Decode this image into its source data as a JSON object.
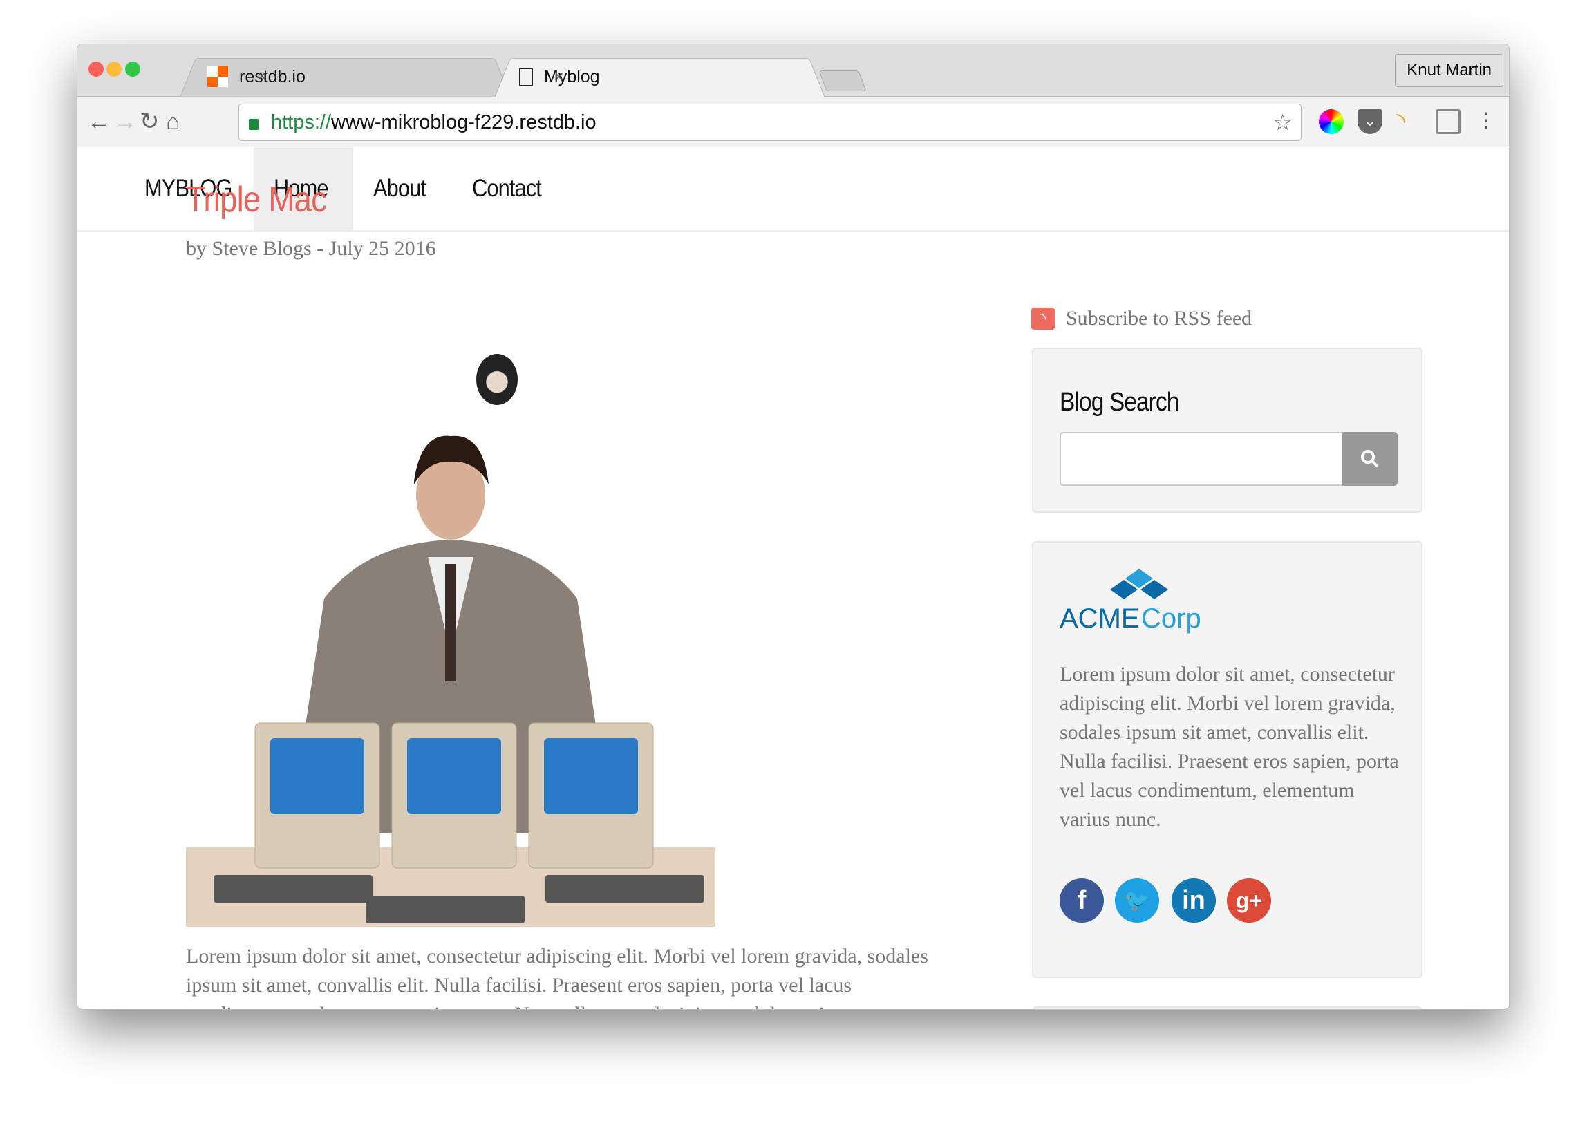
{
  "browser": {
    "tabs": [
      {
        "label": "restdb.io",
        "close": "×"
      },
      {
        "label": "Myblog",
        "close": "×"
      }
    ],
    "user": "Knut Martin",
    "url_scheme": "https://",
    "url_host": "www-mikroblog-f229.restdb.io",
    "icons": [
      "back-arrow",
      "forward-arrow",
      "reload",
      "home",
      "lock",
      "star",
      "color-picker",
      "pocket",
      "rss",
      "cast",
      "menu"
    ]
  },
  "nav": {
    "brand": "MYBLOG",
    "items": [
      {
        "label": "Home",
        "active": true
      },
      {
        "label": "About"
      },
      {
        "label": "Contact"
      }
    ]
  },
  "post": {
    "title": "Triple Mac",
    "byline": "by Steve Blogs - July 25 2016",
    "body": "Lorem ipsum dolor sit amet, consectetur adipiscing elit. Morbi vel lorem gravida, sodales ipsum sit amet, convallis elit. Nulla facilisi. Praesent eros sapien, porta vel lacus condimentum, elementum varius nunc. Nam tellus ante, lacinia nec dolor quis, ornare tristique ante."
  },
  "sidebar": {
    "rss_label": "Subscribe to RSS feed",
    "search_title": "Blog Search",
    "search_value": "",
    "logo_text_1": "ACME",
    "logo_text_2": "Corp",
    "about_text": "Lorem ipsum dolor sit amet, consectetur adipiscing elit. Morbi vel lorem gravida, sodales ipsum sit amet, convallis elit. Nulla facilisi. Praesent eros sapien, porta vel lacus condimentum, elementum varius nunc.",
    "social": [
      {
        "name": "facebook",
        "glyph": "f",
        "color": "#3b5998"
      },
      {
        "name": "twitter",
        "glyph": "🐦",
        "color": "#1da1e2"
      },
      {
        "name": "linkedin",
        "glyph": "in",
        "color": "#1178b3"
      },
      {
        "name": "google-plus",
        "glyph": "g+",
        "color": "#dc4a38"
      }
    ]
  },
  "colors": {
    "accent": "#e8635a",
    "url_green": "#1e8a3e",
    "logo_dark": "#0a6aa8",
    "logo_light": "#2a9fd8"
  }
}
